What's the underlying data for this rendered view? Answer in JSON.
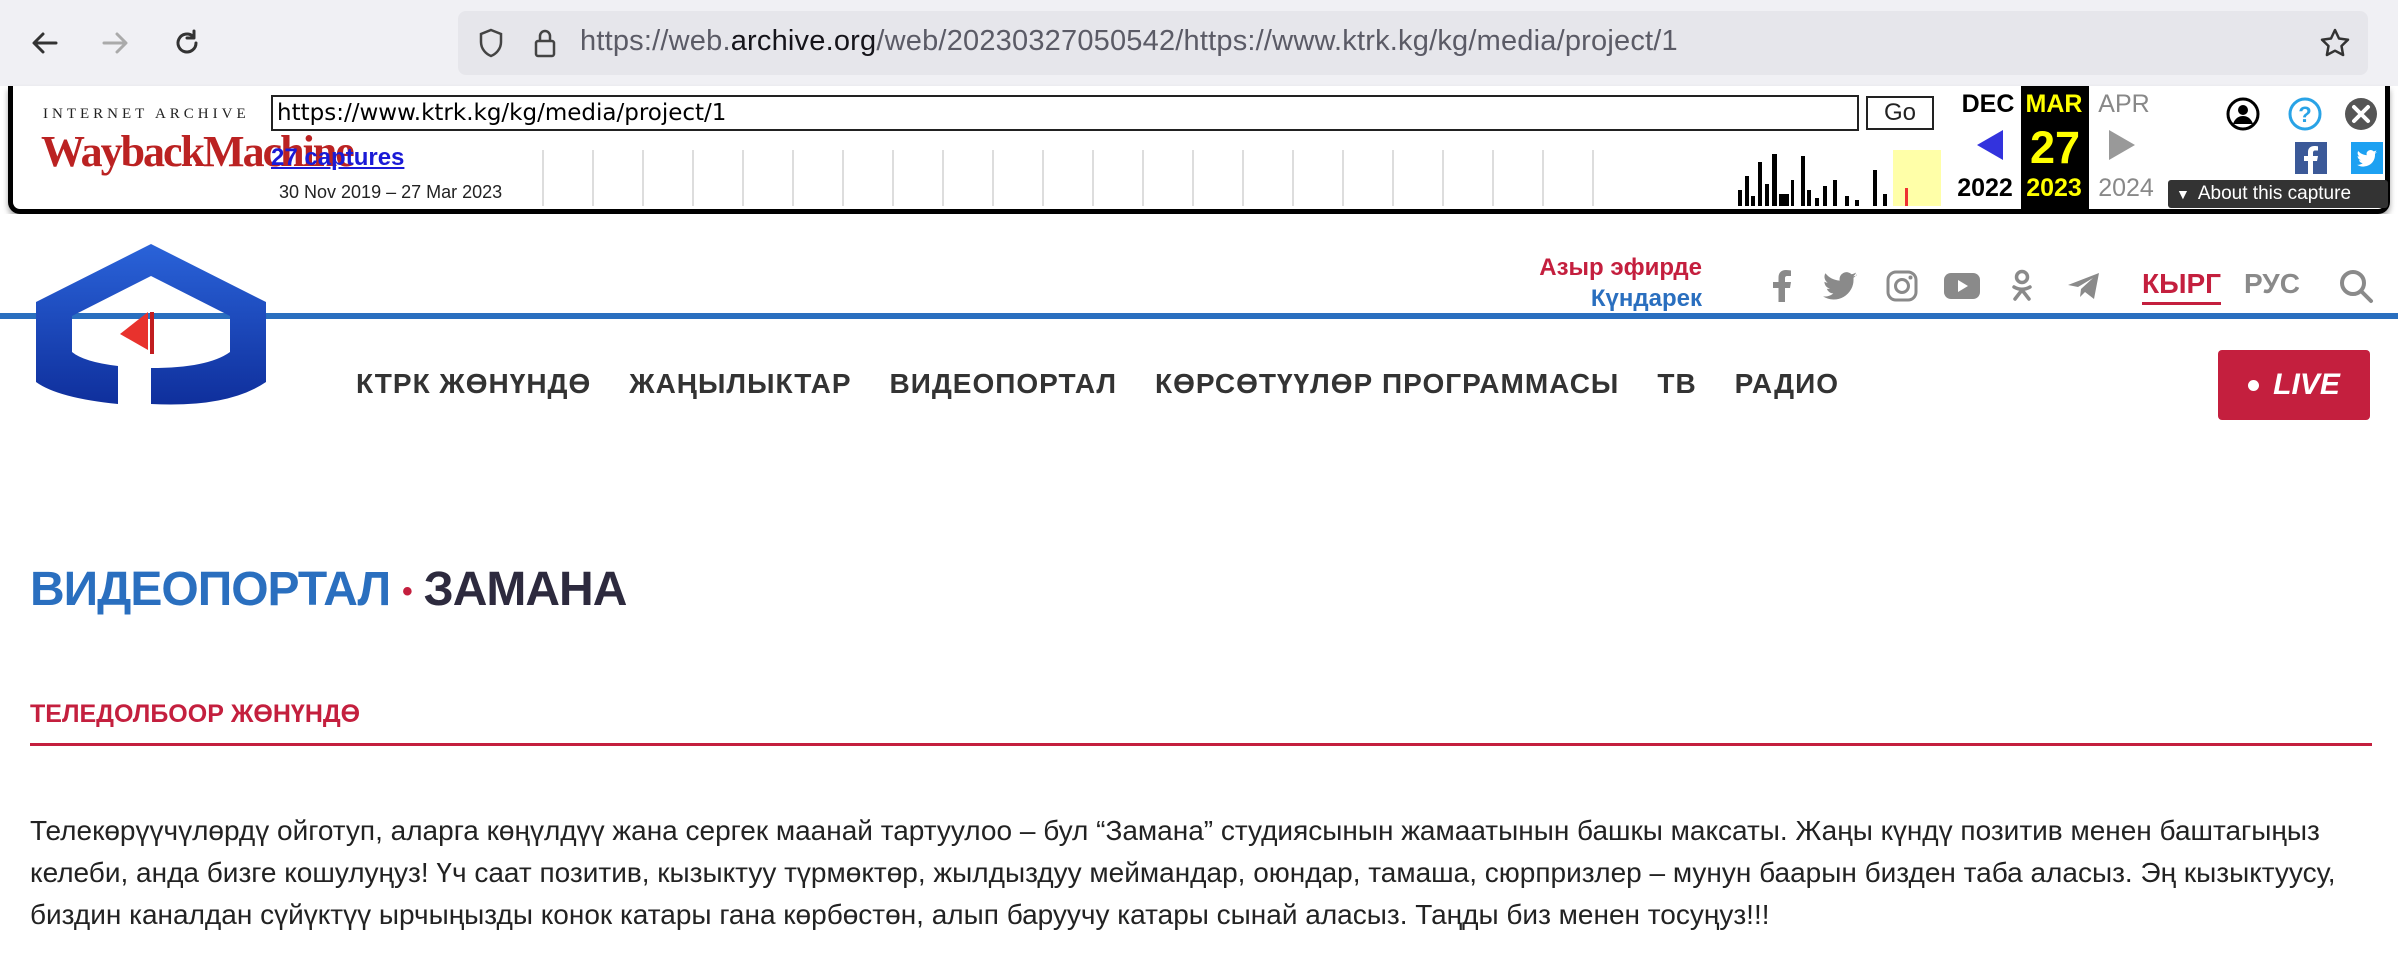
{
  "browser": {
    "url_prefix": "https://web.",
    "url_domain": "archive.org",
    "url_rest": "/web/20230327050542/https://www.ktrk.kg/kg/media/project/1"
  },
  "wayback": {
    "logo_top": "INTERNET ARCHIVE",
    "logo": "WaybackMachine",
    "url_value": "https://www.ktrk.kg/kg/media/project/1",
    "go_label": "Go",
    "captures": "27 captures",
    "range": "30 Nov 2019 – 27 Mar 2023",
    "prev_month": "DEC",
    "cur_month": "MAR",
    "cur_day": "27",
    "cur_year": "2023",
    "next_month": "APR",
    "prev_year": "2022",
    "next_year": "2024",
    "about": "About this capture"
  },
  "header": {
    "live_now": "Азыр эфирде",
    "schedule": "Күндарек",
    "social": [
      "facebook-icon",
      "twitter-icon",
      "instagram-icon",
      "youtube-icon",
      "odnoklassniki-icon",
      "telegram-icon"
    ],
    "lang_ky": "КЫРГ",
    "lang_ru": "РУС",
    "nav": [
      "КТРК ЖӨНҮНДӨ",
      "ЖАҢЫЛЫКТАР",
      "ВИДЕОПОРТАЛ",
      "КӨРСӨТҮҮЛӨР ПРОГРАММАСЫ",
      "ТВ",
      "РАДИО"
    ],
    "live_label": "LIVE"
  },
  "content": {
    "crumb_section": "ВИДЕОПОРТАЛ",
    "crumb_sep": "•",
    "crumb_page": "ЗАМАНА",
    "section_title": "ТЕЛЕДОЛБООР ЖӨНҮНДӨ",
    "description": "Телекөрүүчүлөрдү ойготуп, аларга көңүлдүү жана сергек маанай тартуулоо – бул “Замана” студиясынын жамаатынын башкы максаты. Жаңы күндү позитив менен баштагыңыз келеби, анда бизге кошулуңуз! Үч саат позитив, кызыктуу түрмөктөр, жылдыздуу меймандар, оюндар, тамаша, сюрпризлер – мунун баарын бизден таба аласыз. Эң кызыктуусу, биздин каналдан сүйүктүү ырчыңызды конок катары гана көрбөстөн, алып баруучу катары сынай аласыз. Таңды биз менен тосуңуз!!!"
  },
  "colors": {
    "accent_red": "#c41f3e",
    "accent_blue": "#2a6fbf"
  }
}
